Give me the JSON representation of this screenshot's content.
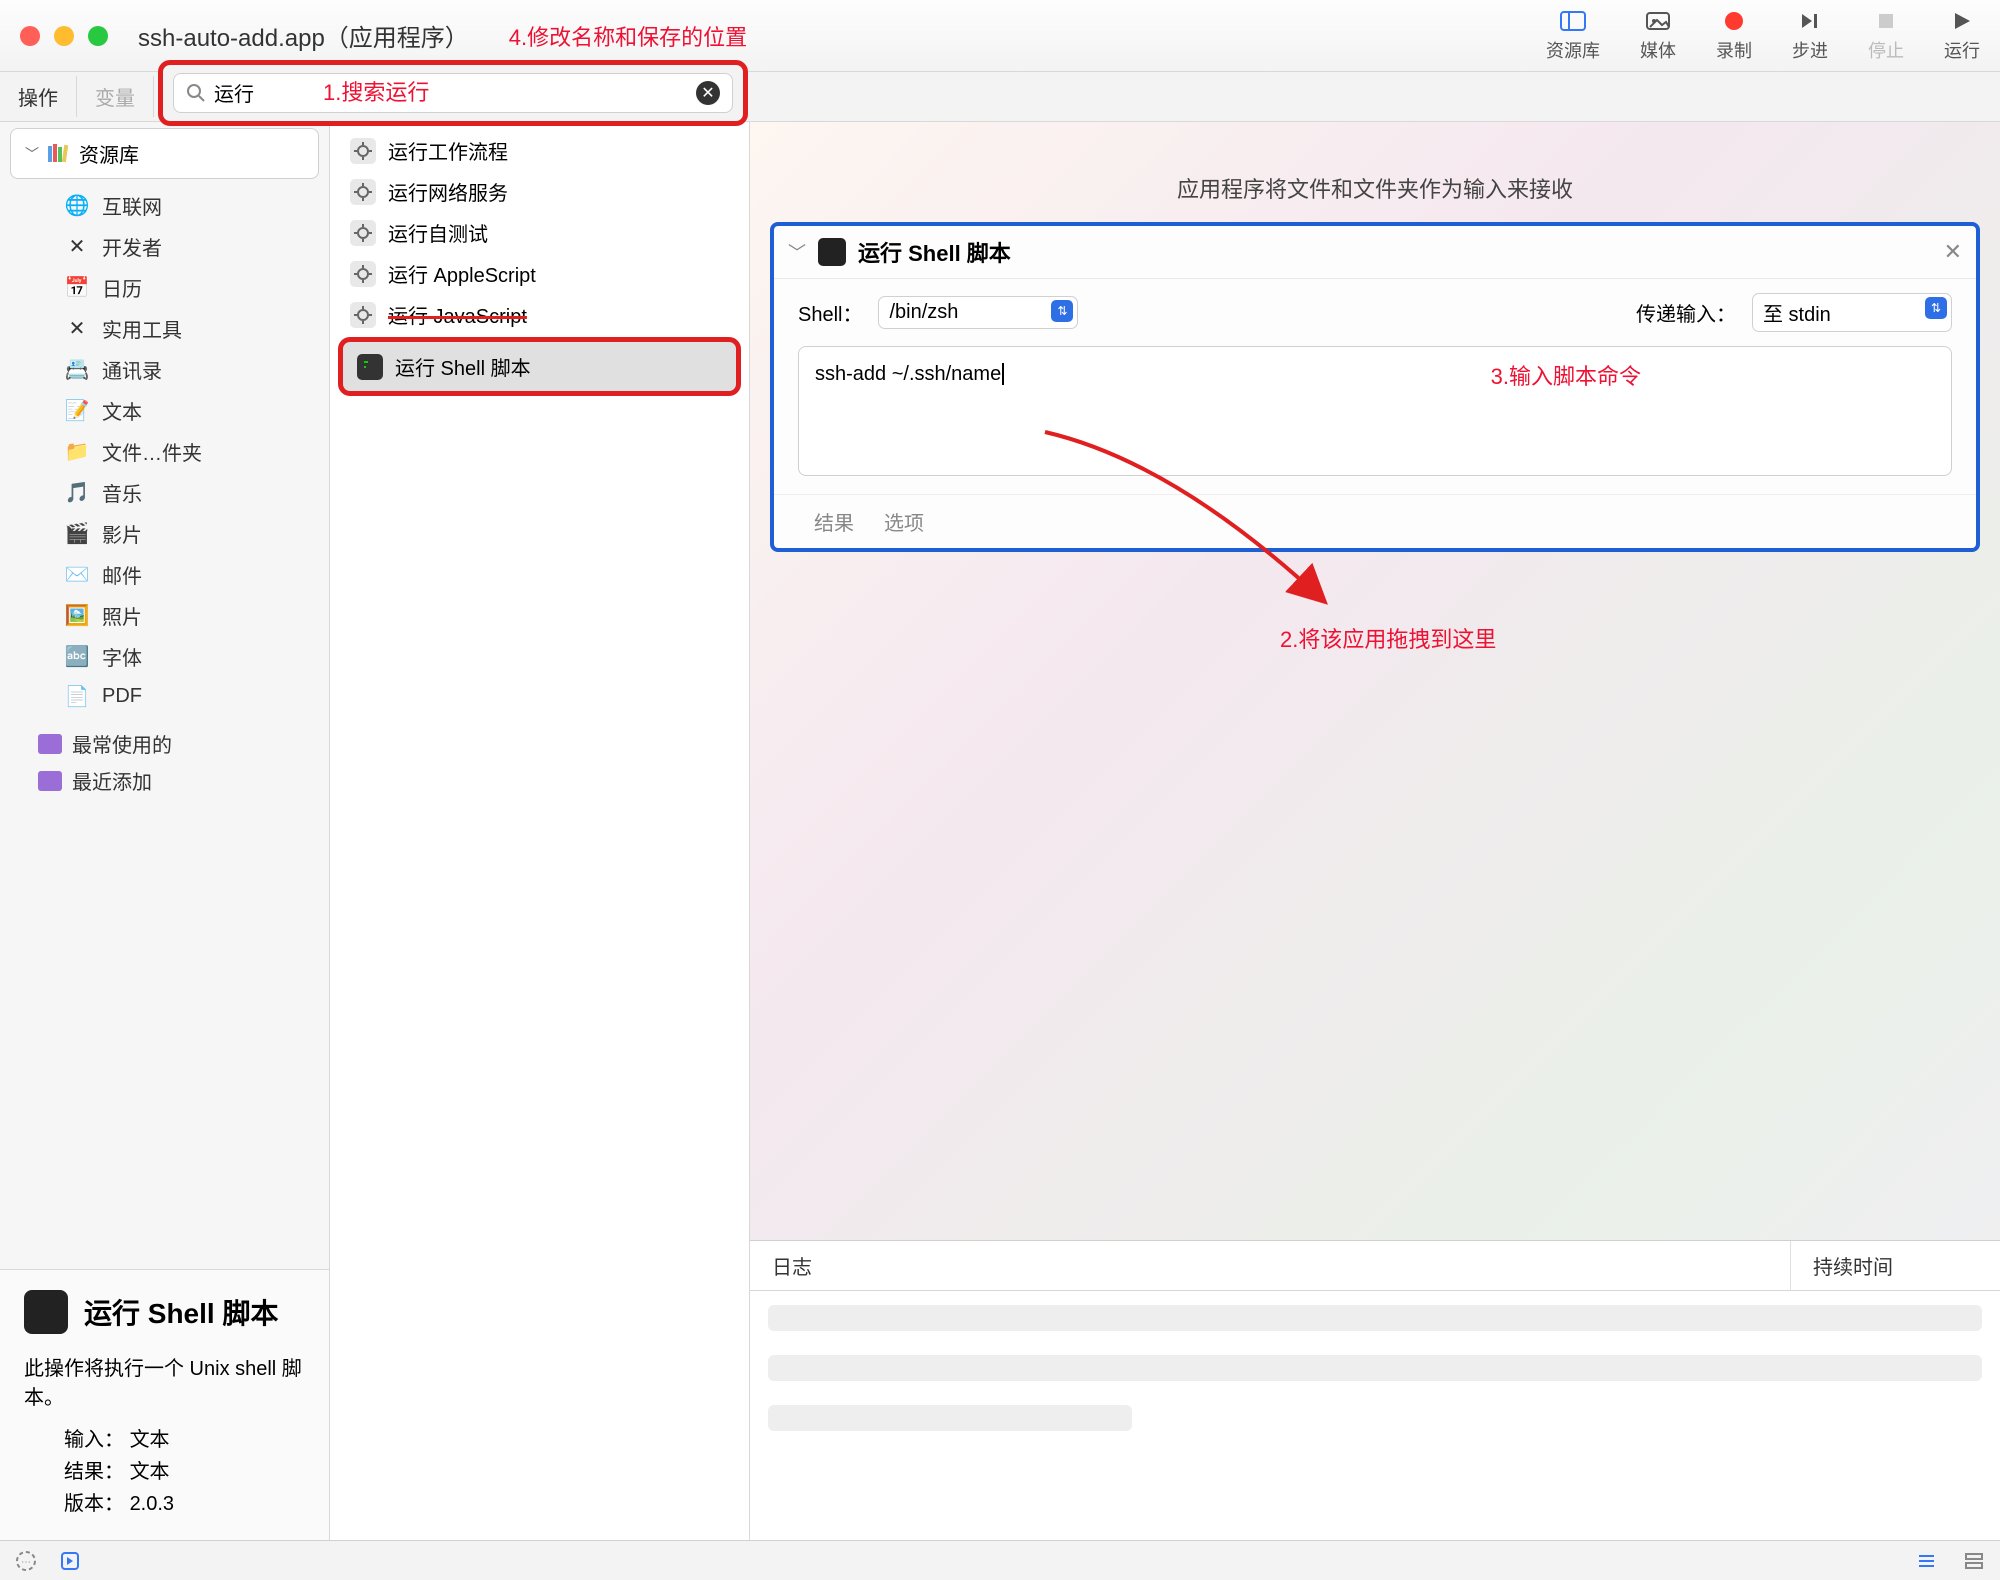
{
  "window": {
    "title": "ssh-auto-add.app（应用程序）"
  },
  "annotations": {
    "a1": "1.搜索运行",
    "a2": "2.将该应用拖拽到这里",
    "a3": "3.输入脚本命令",
    "a4": "4.修改名称和保存的位置"
  },
  "toolbar": {
    "library": "资源库",
    "media": "媒体",
    "record": "录制",
    "step": "步进",
    "stop": "停止",
    "run": "运行"
  },
  "tabs": {
    "actions": "操作",
    "variables": "变量"
  },
  "search": {
    "value": "运行"
  },
  "sidebar": {
    "header": "资源库",
    "items": [
      {
        "icon": "🌐",
        "label": "互联网"
      },
      {
        "icon": "✕",
        "label": "开发者"
      },
      {
        "icon": "📅",
        "label": "日历"
      },
      {
        "icon": "✕",
        "label": "实用工具"
      },
      {
        "icon": "📇",
        "label": "通讯录"
      },
      {
        "icon": "📝",
        "label": "文本"
      },
      {
        "icon": "📁",
        "label": "文件…件夹"
      },
      {
        "icon": "🎵",
        "label": "音乐"
      },
      {
        "icon": "🎬",
        "label": "影片"
      },
      {
        "icon": "✉️",
        "label": "邮件"
      },
      {
        "icon": "🖼️",
        "label": "照片"
      },
      {
        "icon": "🔤",
        "label": "字体"
      },
      {
        "icon": "📄",
        "label": "PDF"
      }
    ],
    "recent": [
      {
        "label": "最常使用的"
      },
      {
        "label": "最近添加"
      }
    ]
  },
  "actions_list": [
    {
      "label": "运行工作流程"
    },
    {
      "label": "运行网络服务"
    },
    {
      "label": "运行自测试"
    },
    {
      "label": "运行 AppleScript"
    },
    {
      "label": "运行 JavaScript",
      "struck": true
    },
    {
      "label": "运行 Shell 脚本",
      "selected": true
    }
  ],
  "canvas": {
    "hint": "应用程序将文件和文件夹作为输入来接收"
  },
  "panel": {
    "title": "运行 Shell 脚本",
    "shell_label": "Shell：",
    "shell_value": "/bin/zsh",
    "pass_label": "传递输入：",
    "pass_value": "至 stdin",
    "script": "ssh-add ~/.ssh/name",
    "footer": {
      "results": "结果",
      "options": "选项"
    }
  },
  "log": {
    "col1": "日志",
    "col2": "持续时间"
  },
  "info": {
    "title": "运行 Shell 脚本",
    "desc": "此操作将执行一个 Unix shell 脚本。",
    "input_k": "输入：",
    "input_v": "文本",
    "result_k": "结果：",
    "result_v": "文本",
    "version_k": "版本：",
    "version_v": "2.0.3"
  }
}
